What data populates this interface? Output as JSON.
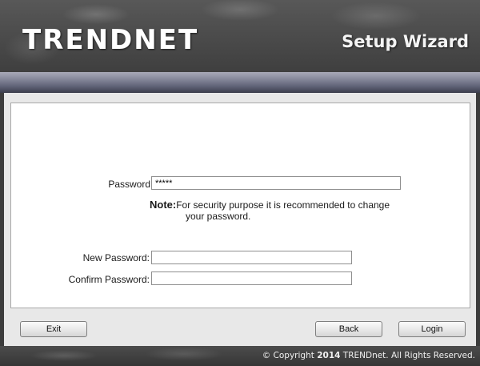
{
  "header": {
    "brand": "TRENDNET",
    "title": "Setup Wizard"
  },
  "form": {
    "password": {
      "label": "Password",
      "value": "*****"
    },
    "note": {
      "label": "Note:",
      "text_line1": "For security purpose it is recommended to change",
      "text_line2": "your password."
    },
    "new_password": {
      "label": "New Password:",
      "value": ""
    },
    "confirm_password": {
      "label": "Confirm Password:",
      "value": ""
    }
  },
  "buttons": {
    "exit": "Exit",
    "back": "Back",
    "login": "Login"
  },
  "footer": {
    "copyright_prefix": "Copyright",
    "copyright_year": "2014",
    "copyright_suffix": "TRENDnet. All Rights Reserved.",
    "copyright_symbol": "©"
  },
  "colors": {
    "title_bar": "#5e6175",
    "panel_background": "#ffffff",
    "content_background": "#e8e8e8"
  }
}
